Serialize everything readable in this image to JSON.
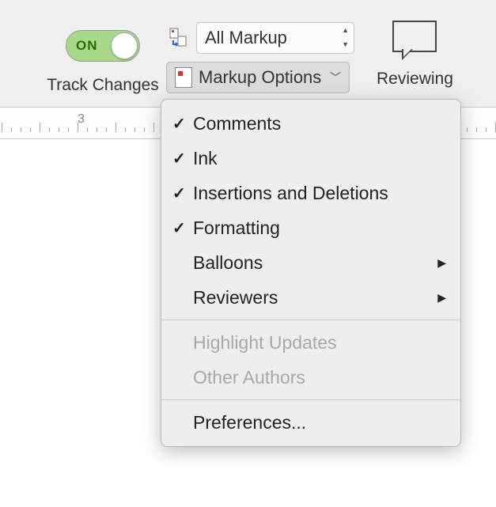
{
  "track_changes": {
    "toggle_text": "ON",
    "label": "Track Changes"
  },
  "markup": {
    "display_select": "All Markup",
    "options_button": "Markup Options"
  },
  "reviewing": {
    "label": "Reviewing"
  },
  "ruler": {
    "marker": "3"
  },
  "menu": {
    "items": [
      {
        "label": "Comments",
        "checked": true,
        "enabled": true,
        "submenu": false
      },
      {
        "label": "Ink",
        "checked": true,
        "enabled": true,
        "submenu": false
      },
      {
        "label": "Insertions and Deletions",
        "checked": true,
        "enabled": true,
        "submenu": false
      },
      {
        "label": "Formatting",
        "checked": true,
        "enabled": true,
        "submenu": false
      },
      {
        "label": "Balloons",
        "checked": false,
        "enabled": true,
        "submenu": true
      },
      {
        "label": "Reviewers",
        "checked": false,
        "enabled": true,
        "submenu": true
      }
    ],
    "disabled_items": [
      {
        "label": "Highlight Updates"
      },
      {
        "label": "Other Authors"
      }
    ],
    "footer": {
      "label": "Preferences..."
    }
  }
}
